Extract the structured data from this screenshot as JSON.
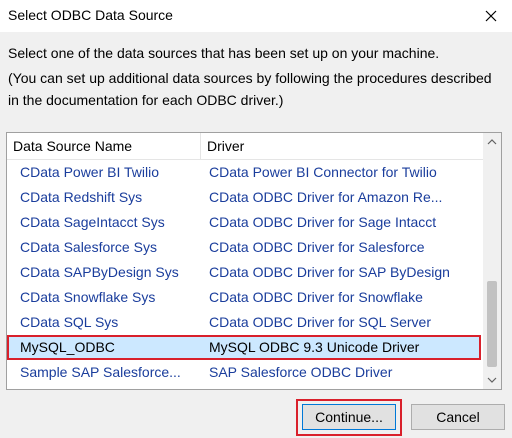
{
  "window": {
    "title": "Select ODBC Data Source",
    "close_icon": "close-icon"
  },
  "description": {
    "line1": "Select one of the data sources that has been set up on your machine.",
    "line2": "(You can set up additional data sources by following the procedures described in the documentation for each ODBC driver.)"
  },
  "list": {
    "columns": [
      "Data Source Name",
      "Driver"
    ],
    "rows": [
      {
        "name": "CData Power BI Twilio",
        "driver": "CData Power BI Connector for Twilio"
      },
      {
        "name": "CData Redshift Sys",
        "driver": "CData ODBC Driver for Amazon Re..."
      },
      {
        "name": "CData SageIntacct Sys",
        "driver": "CData ODBC Driver for Sage Intacct"
      },
      {
        "name": "CData Salesforce Sys",
        "driver": "CData ODBC Driver for Salesforce"
      },
      {
        "name": "CData SAPByDesign Sys",
        "driver": "CData ODBC Driver for SAP ByDesign"
      },
      {
        "name": "CData Snowflake Sys",
        "driver": "CData ODBC Driver for Snowflake"
      },
      {
        "name": "CData SQL Sys",
        "driver": "CData ODBC Driver for SQL Server"
      },
      {
        "name": "MySQL_ODBC",
        "driver": "MySQL ODBC 9.3 Unicode Driver",
        "selected": true
      },
      {
        "name": "Sample SAP Salesforce...",
        "driver": "SAP Salesforce ODBC Driver"
      }
    ]
  },
  "buttons": {
    "continue": "Continue...",
    "cancel": "Cancel"
  },
  "colors": {
    "selection": "#cce8ff",
    "highlight": "#d9202b",
    "link_text": "#1a3d9c"
  }
}
